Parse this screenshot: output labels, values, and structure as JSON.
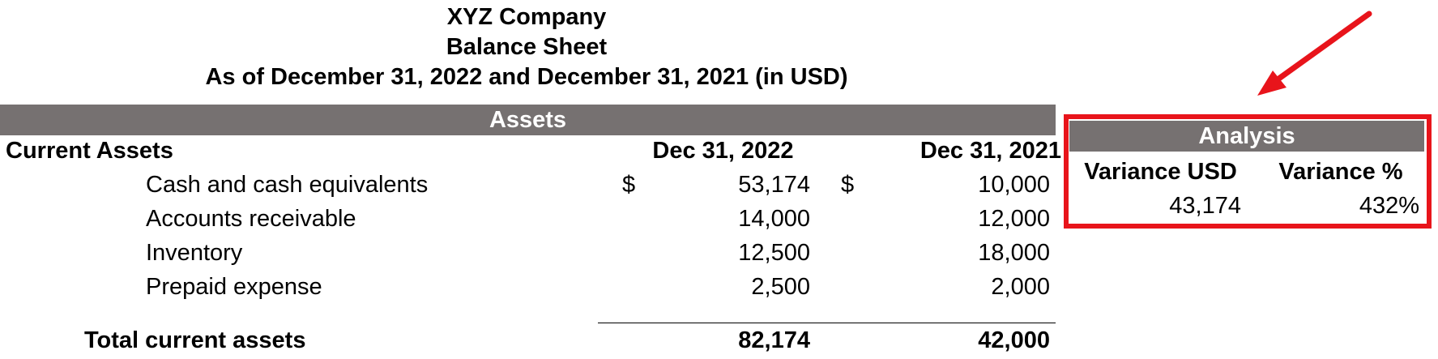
{
  "header": {
    "company": "XYZ Company",
    "statement": "Balance Sheet",
    "period": "As of December 31, 2022 and December 31, 2021  (in USD)"
  },
  "table": {
    "section_title": "Assets",
    "group_label": "Current Assets",
    "col_2022": "Dec 31, 2022",
    "col_2021": "Dec 31, 2021",
    "currency_symbol": "$",
    "rows": [
      {
        "label": "Cash and cash equivalents",
        "y2022": "53,174",
        "y2021": "10,000"
      },
      {
        "label": "Accounts receivable",
        "y2022": "14,000",
        "y2021": "12,000"
      },
      {
        "label": "Inventory",
        "y2022": "12,500",
        "y2021": "18,000"
      },
      {
        "label": "Prepaid expense",
        "y2022": "2,500",
        "y2021": "2,000"
      }
    ],
    "total": {
      "label": "Total current assets",
      "y2022": "82,174",
      "y2021": "42,000"
    }
  },
  "analysis": {
    "title": "Analysis",
    "col_usd": "Variance USD",
    "col_pct": "Variance %",
    "variance_usd": "43,174",
    "variance_pct": "432%"
  },
  "colors": {
    "band_gray": "#767171",
    "highlight_red": "#e8141b"
  }
}
